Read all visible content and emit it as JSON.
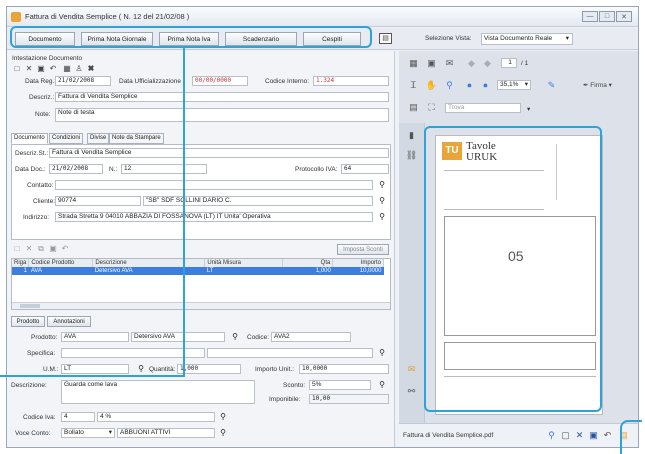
{
  "window": {
    "title": "Fattura di Vendita Semplice ( N. 12 del 21/02/08 )",
    "min": "—",
    "max": "□",
    "close": "✕"
  },
  "toolbar": {
    "documento": "Documento",
    "prima_nota_giornale": "Prima Nota Giornale",
    "prima_nota_iva": "Prima Nota Iva",
    "scadenzario": "Scadenzario",
    "cespiti": "Cespiti",
    "selezione_vista_label": "Selezione Vista:",
    "selezione_vista_value": "Vista Documento Reale"
  },
  "header": {
    "section_title": "Intestazione Documento",
    "data_reg_label": "Data Reg.:",
    "data_reg_value": "21/02/2008",
    "data_uff_label": "Data Ufficializzazione",
    "data_uff_value": "00/00/0000",
    "codice_interno_label": "Codice Interno:",
    "codice_interno_value": "1.324",
    "descriz_label": "Descriz.:",
    "descriz_value": "Fattura di Vendita Semplice",
    "note_label": "Note:",
    "note_value": "Note di testa"
  },
  "tabs": [
    "Documento",
    "Condizioni",
    "Divise",
    "Note da Stampare"
  ],
  "documento": {
    "descriz_st_label": "Descriz.St.:",
    "descriz_st_value": "Fattura di Vendita Semplice",
    "data_doc_label": "Data Doc.:",
    "data_doc_value": "21/02/2008",
    "n_label": "N.:",
    "n_value": "12",
    "protocollo_label": "Protocollo IVA:",
    "protocollo_value": "64",
    "contatto_label": "Contatto:",
    "contatto_value": "",
    "cliente_label": "Cliente:",
    "cliente_code": "90774",
    "cliente_name": "\"SB\" SDF SOLLINI DARIO C.",
    "indirizzo_label": "Indirizzo:",
    "indirizzo_value": "Strada Stretta 9 04010 ABBAZIA DI FOSSANOVA (LT) IT Unita' Operativa"
  },
  "rows_toolbar": {
    "imposta_sconti": "Imposta Sconti"
  },
  "righe": {
    "columns": [
      "Riga",
      "Codice Prodotto",
      "Descrizione",
      "Unità Misura",
      "Qta",
      "Importo"
    ],
    "rows": [
      {
        "riga": "1",
        "codice": "AVA",
        "descrizione": "Detersivo AVA",
        "um": "LT",
        "qta": "1,000",
        "importo": "10,0000"
      }
    ]
  },
  "sub_tabs": {
    "prodotto": "Prodotto",
    "annotazioni": "Annotazioni"
  },
  "prodotto": {
    "prodotto_label": "Prodotto:",
    "prodotto_code": "AVA",
    "prodotto_desc": "Detersivo AVA",
    "codice_label": "Codice:",
    "codice_value": "AVA2",
    "specifica_label": "Specifica:",
    "specifica_value": "",
    "um_label": "U.M.:",
    "um_value": "LT",
    "quantita_label": "Quantità:",
    "quantita_value": "1,000",
    "importo_unit_label": "Importo Unit.:",
    "importo_unit_value": "10,0000",
    "descrizione_label": "Descrizione:",
    "descrizione_value": "Guarda come lava",
    "sconto_label": "Sconto:",
    "sconto_value": "5%",
    "imponibile_label": "Imponibile:",
    "imponibile_value": "10,00",
    "codice_iva_label": "Codice Iva:",
    "codice_iva_code": "4",
    "codice_iva_desc": "4 %",
    "voce_conto_label": "Voce Conto:",
    "voce_conto_value": "Bollato",
    "voce_conto_desc": "ABBUONI ATTIVI"
  },
  "viewer": {
    "page": "1",
    "of_pages": "/ 1",
    "zoom": "35,1%",
    "firma": "Firma",
    "trova_placeholder": "Trova",
    "filename": "Fattura di Vendita Semplice.pdf",
    "doc_logo_tu": "TU",
    "doc_logo_name": "Tavole",
    "doc_logo_sub": "URUK",
    "doc_big_number": "05"
  },
  "colors": {
    "highlight": "#2fa2d8",
    "selection": "#3d7de0",
    "red_value": "#d23030"
  }
}
